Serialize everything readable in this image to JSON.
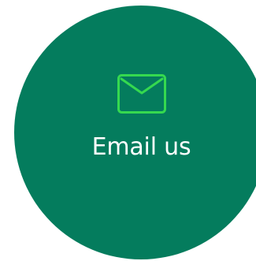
{
  "cta": {
    "label": "Email us",
    "icon": "envelope-icon"
  },
  "colors": {
    "circle_background": "#047c5d",
    "icon_stroke": "#35d94f",
    "label_text": "#ffffff"
  }
}
